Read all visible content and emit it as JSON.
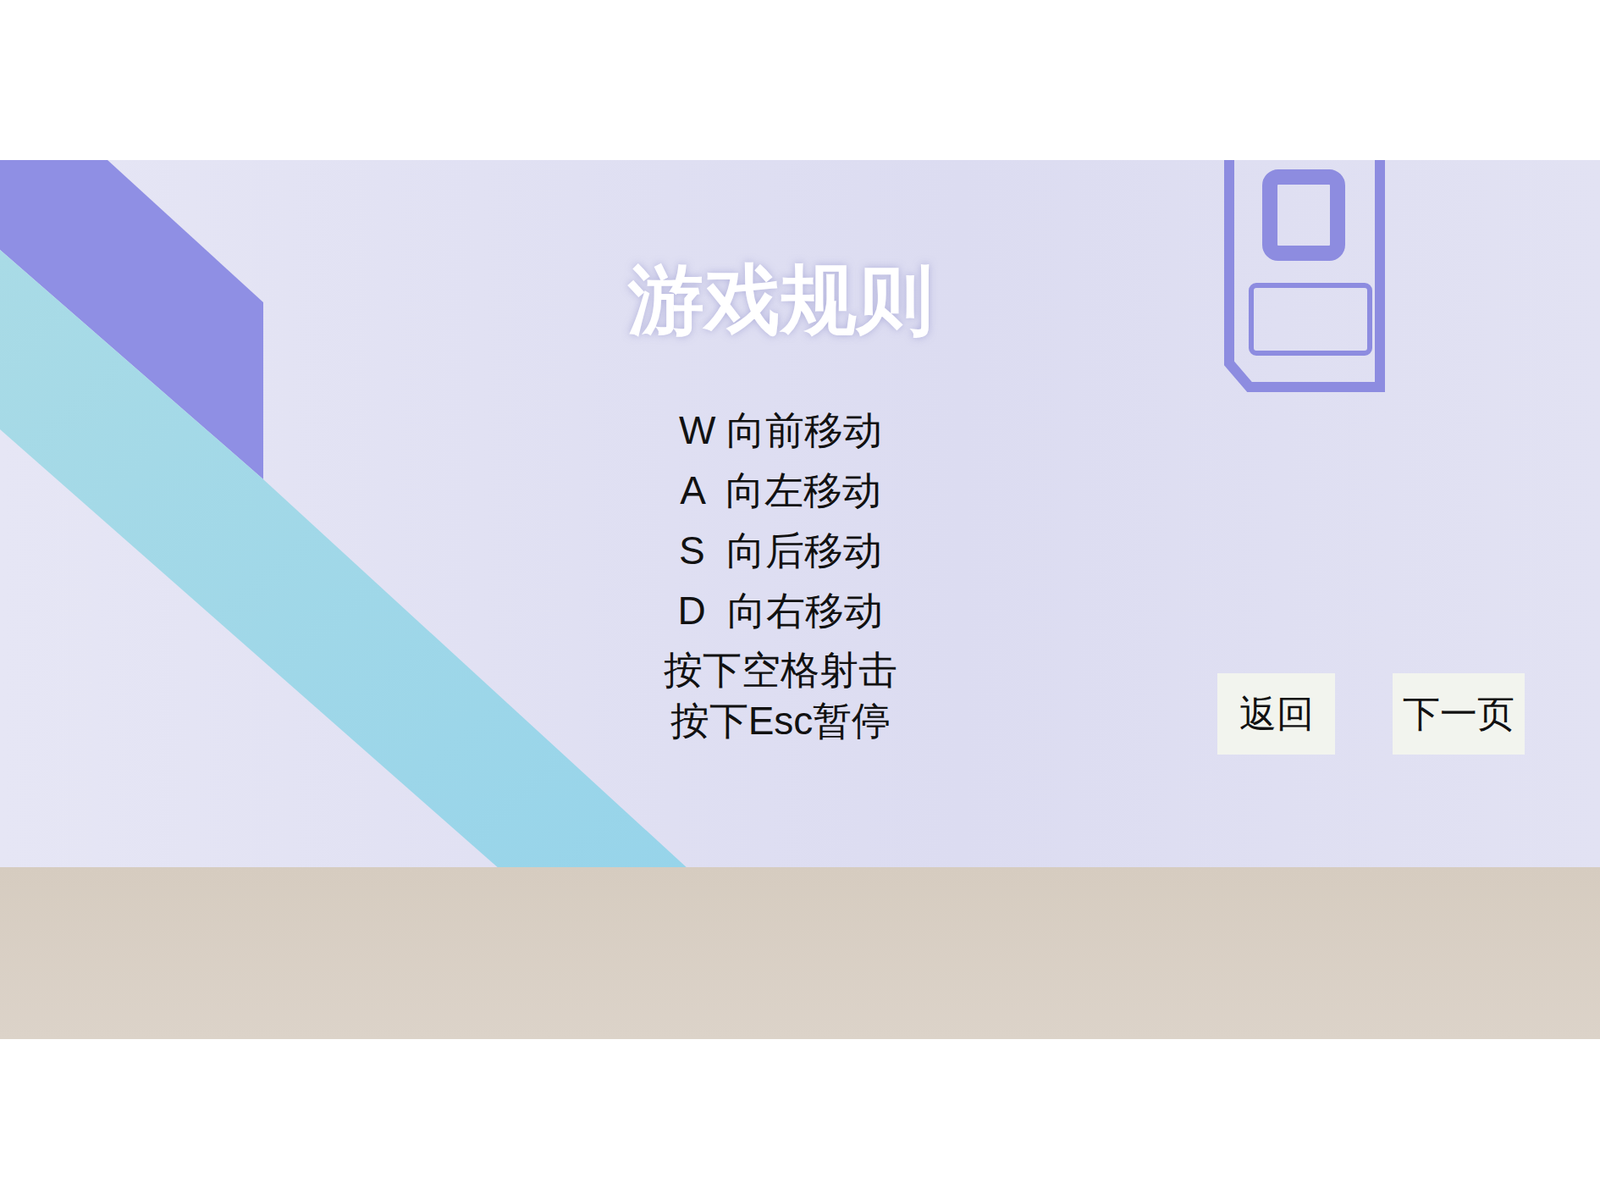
{
  "screen": {
    "title": "游戏规则"
  },
  "controls": [
    "W 向前移动",
    "A  向左移动",
    "S  向后移动",
    "D  向右移动"
  ],
  "actions": [
    "按下空格射击",
    "按下Esc暂停"
  ],
  "buttons": [
    "返回",
    "下一页"
  ]
}
